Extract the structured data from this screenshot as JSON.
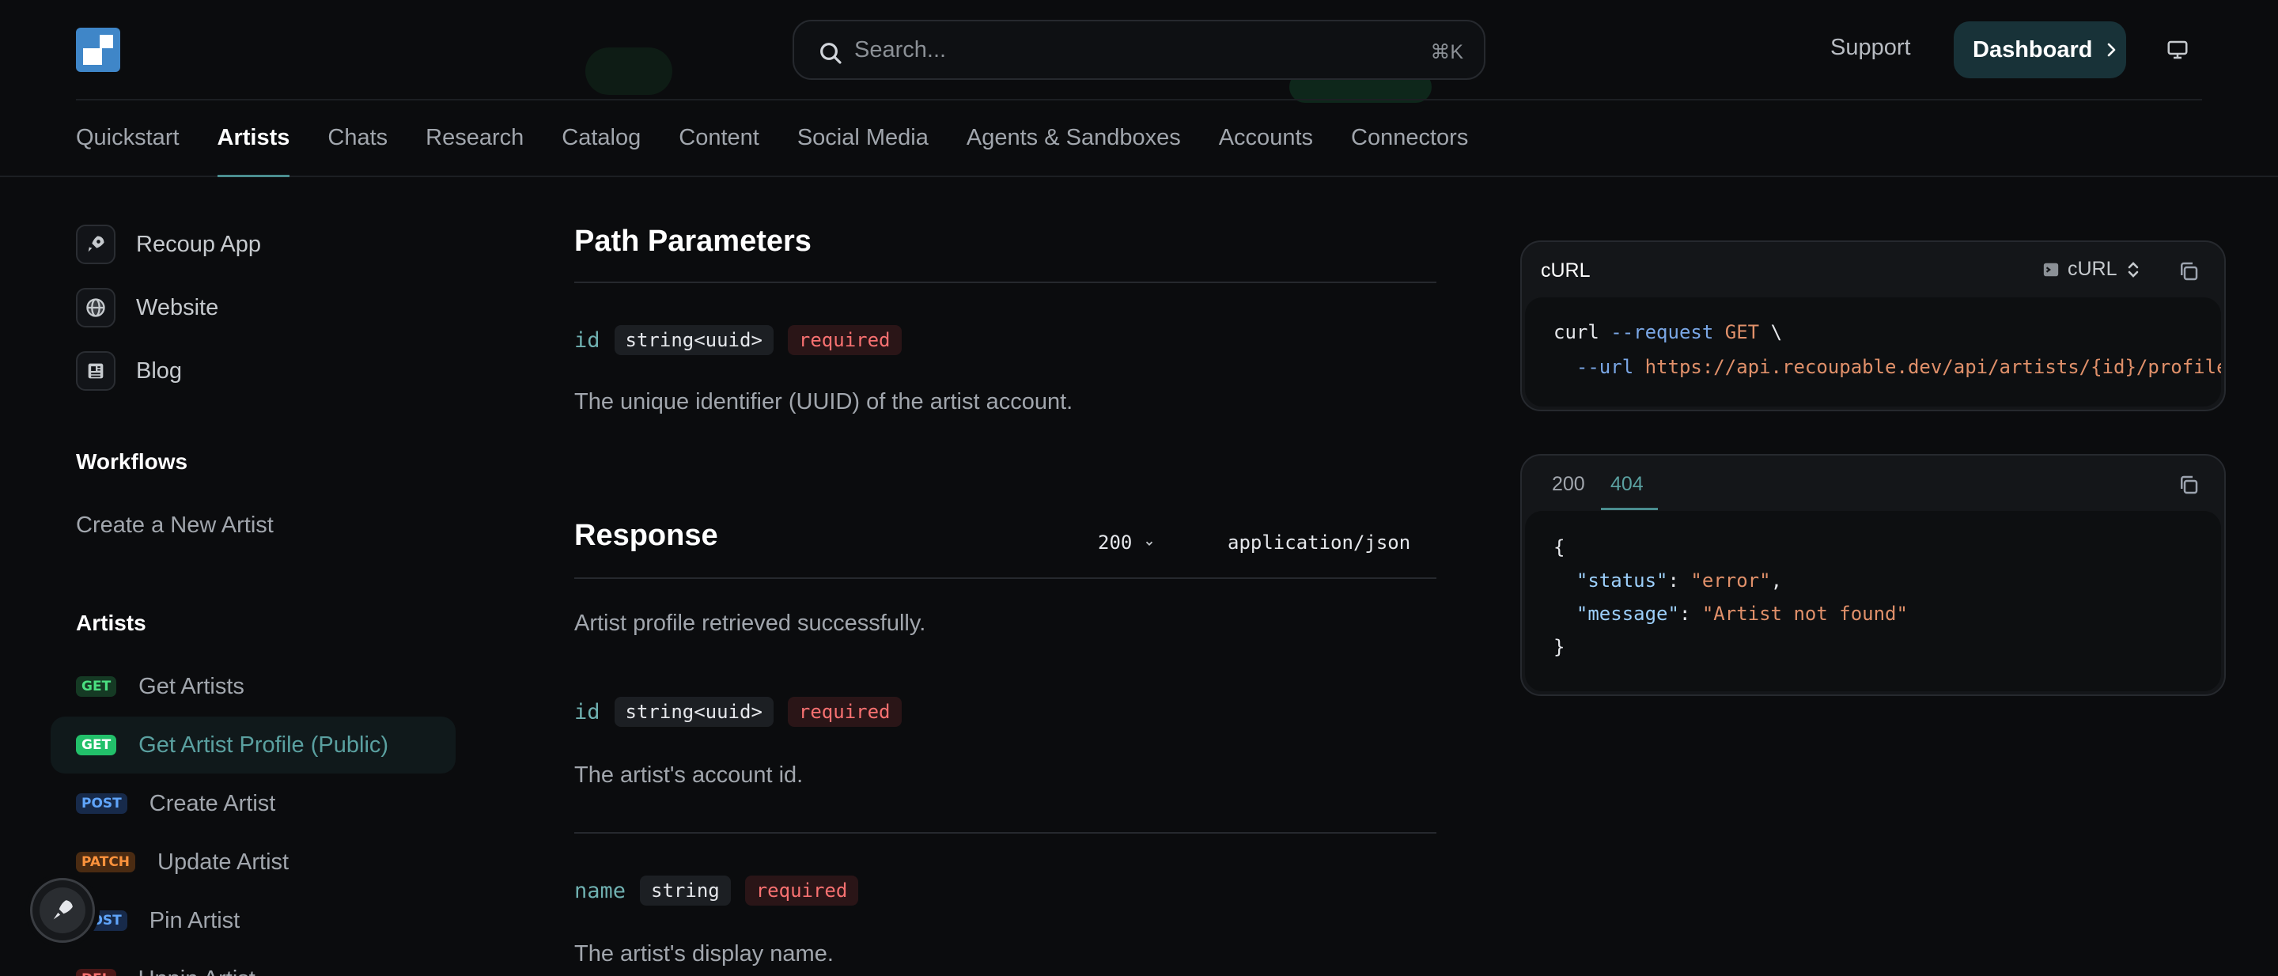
{
  "header": {
    "search_placeholder": "Search...",
    "search_shortcut": "⌘K",
    "support_label": "Support",
    "dashboard_label": "Dashboard"
  },
  "tabs": [
    "Quickstart",
    "Artists",
    "Chats",
    "Research",
    "Catalog",
    "Content",
    "Social Media",
    "Agents & Sandboxes",
    "Accounts",
    "Connectors"
  ],
  "active_tab": "Artists",
  "sidebar": {
    "external_links": [
      {
        "label": "Recoup App",
        "icon": "rocket-icon"
      },
      {
        "label": "Website",
        "icon": "globe-icon"
      },
      {
        "label": "Blog",
        "icon": "newspaper-icon"
      }
    ],
    "workflows_title": "Workflows",
    "workflows": [
      "Create a New Artist"
    ],
    "artists_title": "Artists",
    "endpoints": [
      {
        "method": "GET",
        "label": "Get Artists"
      },
      {
        "method": "GET",
        "label": "Get Artist Profile (Public)"
      },
      {
        "method": "POST",
        "label": "Create Artist"
      },
      {
        "method": "PATCH",
        "label": "Update Artist"
      },
      {
        "method": "POST",
        "label": "Pin Artist"
      },
      {
        "method": "DEL",
        "label": "Unpin Artist"
      }
    ]
  },
  "main": {
    "path_params_title": "Path Parameters",
    "path_param": {
      "name": "id",
      "type": "string<uuid>",
      "required": "required",
      "description": "The unique identifier (UUID) of the artist account."
    },
    "response_title": "Response",
    "response_code": "200",
    "response_content_type": "application/json",
    "response_description": "Artist profile retrieved successfully.",
    "fields": [
      {
        "name": "id",
        "type": "string<uuid>",
        "required": "required",
        "description": "The artist's account id."
      },
      {
        "name": "name",
        "type": "string",
        "required": "required",
        "description": "The artist's display name."
      }
    ]
  },
  "request_panel": {
    "title": "cURL",
    "language": "cURL",
    "line1": {
      "cmd": "curl",
      "flag": "--request",
      "method": "GET",
      "cont": "\\"
    },
    "line2": {
      "flag": "--url",
      "url": "https://api.recoupable.dev/api/artists/{id}/profile"
    }
  },
  "response_panel": {
    "tabs": [
      "200",
      "404"
    ],
    "active_tab": "404",
    "open_brace": "{",
    "lines": [
      {
        "key": "\"status\"",
        "value": "\"error\"",
        "trail": ","
      },
      {
        "key": "\"message\"",
        "value": "\"Artist not found\"",
        "trail": ""
      }
    ],
    "close_brace": "}"
  },
  "colors": {
    "background": "#0b0c0e",
    "accent": "#4a8d8f",
    "get": "#22c06a",
    "post": "#60a5fa",
    "patch": "#fb923c",
    "delete": "#f87171",
    "required": "#f87171"
  }
}
